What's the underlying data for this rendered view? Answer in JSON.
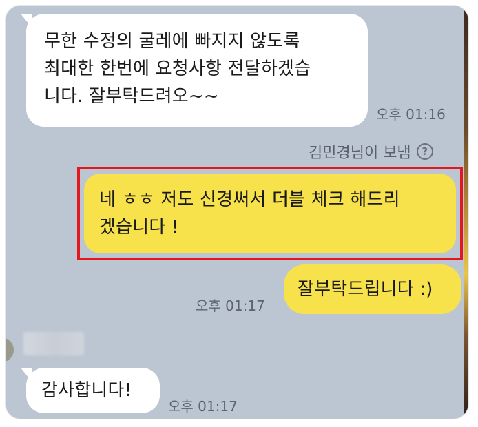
{
  "messages": {
    "m1": {
      "lines": [
        "무한 수정의 굴레에 빠지지 않도록",
        "최대한 한번에 요청사항 전달하겠습",
        "니다. 잘부탁드려오~~"
      ],
      "time": "오후 01:16"
    },
    "sent_by": {
      "label": "김민경님이 보냄",
      "icon": "?"
    },
    "m2": {
      "lines": [
        "네 ㅎㅎ 저도 신경써서 더블 체크 해드리",
        "겠습니다 !"
      ]
    },
    "m3": {
      "text": "잘부탁드립니다 :)",
      "time": "오후 01:17"
    },
    "m4": {
      "text": "감사합니다!",
      "time": "오후 01:17"
    }
  },
  "colors": {
    "chat_background": "#bcc5d2",
    "outgoing_bubble": "#f7e24b",
    "incoming_bubble": "#ffffff",
    "highlight": "#e5161c"
  }
}
